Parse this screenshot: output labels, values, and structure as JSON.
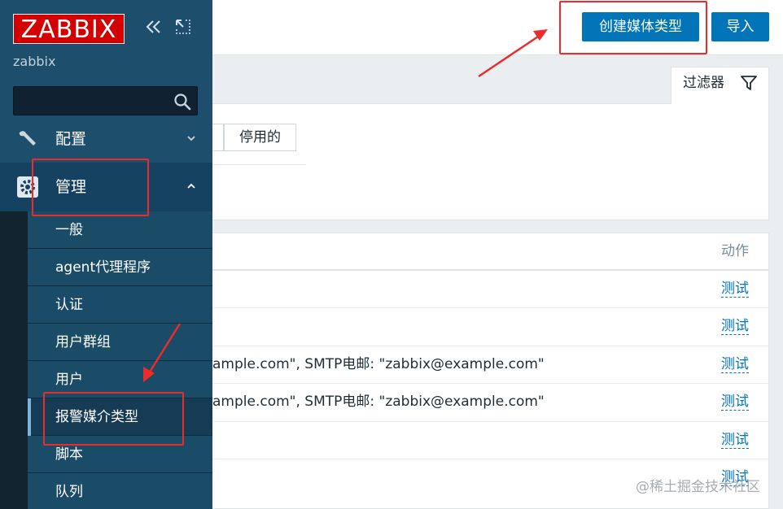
{
  "sidebar": {
    "logo": "ZABBIX",
    "username": "zabbix",
    "search": {
      "value": "",
      "placeholder": ""
    },
    "nav": {
      "config": "配置",
      "admin": "管理"
    },
    "admin_items": [
      {
        "label": "一般"
      },
      {
        "label": "agent代理程序"
      },
      {
        "label": "认证"
      },
      {
        "label": "用户群组"
      },
      {
        "label": "用户"
      },
      {
        "label": "报警媒介类型"
      },
      {
        "label": "脚本"
      },
      {
        "label": "队列"
      }
    ]
  },
  "header": {
    "create_button": "创建媒体类型",
    "import_button": "导入"
  },
  "filter": {
    "tab_label": "过滤器",
    "status_disabled": "停用的"
  },
  "table": {
    "actions_header": "动作",
    "rows": [
      {
        "text": "",
        "action": "测试"
      },
      {
        "text": "",
        "action": "测试"
      },
      {
        "text": "ample.com\", SMTP电邮: \"zabbix@example.com\"",
        "action": "测试"
      },
      {
        "text": "ample.com\", SMTP电邮: \"zabbix@example.com\"",
        "action": "测试"
      },
      {
        "text": "",
        "action": "测试"
      },
      {
        "text": "",
        "action": "测试"
      }
    ]
  },
  "watermark": "@稀土掘金技术社区",
  "colors": {
    "sidebar_top": "#1d4e6b",
    "sidebar_bottom": "#11242f",
    "logo_red": "#d40000",
    "primary_button": "#0275b8",
    "link": "#0275b8",
    "annotation_red": "#ee2b2b"
  }
}
